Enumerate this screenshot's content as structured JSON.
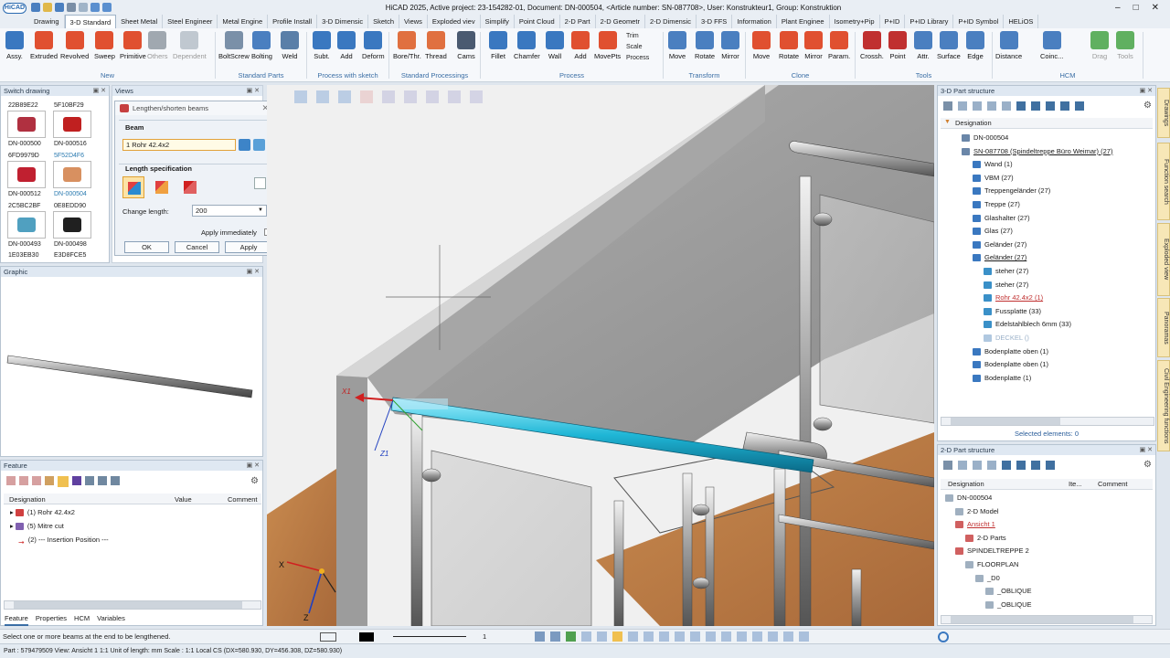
{
  "window": {
    "title": "HiCAD 2025, Active project: 23-154282-01, Document: DN-000504, <Article number: SN-087708>, User: Konstrukteur1, Group: Konstruktion",
    "logo": "HiCAD"
  },
  "tabs": [
    "Drawing",
    "3-D Standard",
    "Sheet Metal",
    "Steel Engineer",
    "Metal Engine",
    "Profile Install",
    "3-D Dimensic",
    "Sketch",
    "Views",
    "Exploded viev",
    "Simplify",
    "Point Cloud",
    "2-D Part",
    "2-D Geometr",
    "2-D Dimensic",
    "3-D FFS",
    "Information",
    "Plant Enginee",
    "Isometry+Pip",
    "P+ID",
    "P+ID Library",
    "P+ID Symbol",
    "HELiOS"
  ],
  "ribbon": {
    "new": [
      "Assy.",
      "Extruded",
      "Revolved",
      "Sweep",
      "Primitive",
      "Others",
      "Dependent"
    ],
    "standard_parts": [
      "BoltScrew",
      "Bolting",
      "Weld"
    ],
    "process_with_sketch": [
      "Subt.",
      "Add",
      "Deform"
    ],
    "standard_processings": [
      "Bore/Thr.",
      "Thread",
      "Cams"
    ],
    "process": [
      "Fillet",
      "Chamfer",
      "Wall",
      "Add",
      "MovePts"
    ],
    "process_small": [
      "Trim",
      "Scale",
      "Process"
    ],
    "transform": [
      "Move",
      "Rotate",
      "Mirror"
    ],
    "clone": [
      "Move",
      "Rotate",
      "Mirror",
      "Param."
    ],
    "tools": [
      "Crossh.",
      "Point",
      "Attr.",
      "Surface",
      "Edge"
    ],
    "hcm": [
      "Distance",
      "Coinc...",
      "Drag",
      "Tools"
    ],
    "groups": [
      "New",
      "Standard Parts",
      "Process with sketch",
      "Standard Processings",
      "Process",
      "Transform",
      "Clone",
      "Tools",
      "HCM"
    ]
  },
  "switch_drawing": {
    "title": "Switch drawing",
    "items": [
      {
        "top": "22B89E22",
        "bottom": "DN-000500"
      },
      {
        "top": "5F10BF29",
        "bottom": "DN-000516"
      },
      {
        "top": "6FD9979D",
        "bottom": "DN-000512"
      },
      {
        "top": "5F52D4F6",
        "bottom": "DN-000504"
      },
      {
        "top": "2C5BC2BF",
        "bottom": "DN-000493"
      },
      {
        "top": "0E8EDD90",
        "bottom": "DN-000498"
      }
    ],
    "last": [
      "1E03EB30",
      "E3D8FCE5"
    ]
  },
  "views_title": "Views",
  "dialog": {
    "title": "Lengthen/shorten beams",
    "beam_label": "Beam",
    "beam_value": "1 Rohr 42.4x2",
    "length_label": "Length specification",
    "change_length_label": "Change length:",
    "change_length_value": "200",
    "apply_immediately": "Apply immediately",
    "ok": "OK",
    "cancel": "Cancel",
    "apply": "Apply"
  },
  "graphic_title": "Graphic",
  "feature": {
    "title": "Feature",
    "columns": [
      "Designation",
      "Value",
      "Comment"
    ],
    "rows": [
      "(1) Rohr 42.4x2",
      "(5) Mitre cut",
      "(2) --- Insertion Position ---"
    ],
    "bottom_tabs": [
      "Feature",
      "Properties",
      "HCM",
      "Variables"
    ]
  },
  "viewport": {
    "axis_x1": "X1",
    "axis_z1": "Z1",
    "axis_x": "X",
    "axis_z": "Z"
  },
  "part_structure_3d": {
    "title": "3-D Part structure",
    "header": "Designation",
    "items": [
      {
        "label": "DN-000504",
        "level": 1
      },
      {
        "label": "SN-087708 (Spindeltreppe Büro Weimar) (27)",
        "level": 1,
        "underline": true
      },
      {
        "label": "Wand (1)",
        "level": 2
      },
      {
        "label": "VBM (27)",
        "level": 2
      },
      {
        "label": "Treppengeländer (27)",
        "level": 2
      },
      {
        "label": "Treppe (27)",
        "level": 2
      },
      {
        "label": "Glashalter (27)",
        "level": 2
      },
      {
        "label": "Glas (27)",
        "level": 2
      },
      {
        "label": "Geländer (27)",
        "level": 2
      },
      {
        "label": "Geländer (27)",
        "level": 2,
        "underline": true
      },
      {
        "label": "steher (27)",
        "level": 3
      },
      {
        "label": "steher (27)",
        "level": 3
      },
      {
        "label": "Rohr 42.4x2 (1)",
        "level": 3,
        "active": true
      },
      {
        "label": "Fussplatte (33)",
        "level": 3
      },
      {
        "label": "Edelstahlblech 6mm (33)",
        "level": 3
      },
      {
        "label": "DECKEL ()",
        "level": 3,
        "dim": true
      },
      {
        "label": "Bodenplatte oben (1)",
        "level": 2
      },
      {
        "label": "Bodenplatte oben (1)",
        "level": 2
      },
      {
        "label": "Bodenplatte (1)",
        "level": 2
      }
    ],
    "selected": "Selected elements: 0"
  },
  "part_structure_2d": {
    "title": "2-D Part structure",
    "columns": [
      "Designation",
      "Ite...",
      "Comment"
    ],
    "items": [
      {
        "label": "DN-000504",
        "level": 0
      },
      {
        "label": "2-D Model",
        "level": 1
      },
      {
        "label": "Ansicht 1",
        "level": 1,
        "underline": true
      },
      {
        "label": "2-D Parts",
        "level": 2
      },
      {
        "label": "SPINDELTREPPE 2",
        "level": 1
      },
      {
        "label": "FLOORPLAN",
        "level": 2
      },
      {
        "label": "_D0",
        "level": 3
      },
      {
        "label": "_OBLIQUE",
        "level": 4
      },
      {
        "label": "_OBLIQUE",
        "level": 4
      }
    ]
  },
  "side_tabs": [
    "Drawings",
    "Function search",
    "Exploded view",
    "Panoramas",
    "Civil Engineering functions"
  ],
  "cmd": {
    "zoom": "1"
  },
  "status": {
    "hint": "Select one or more beams at the end to be lengthened.",
    "line": "Part : 579479509  View: Ansicht 1 1:1  Unit of length: mm  Scale : 1:1  Local CS  (DX=580.930, DY=456.308, DZ=580.930)"
  },
  "colors": {
    "accent": "#3a6ea5",
    "beam": "#1fb6d6",
    "ribbon_bg": "#f6f8fb"
  }
}
